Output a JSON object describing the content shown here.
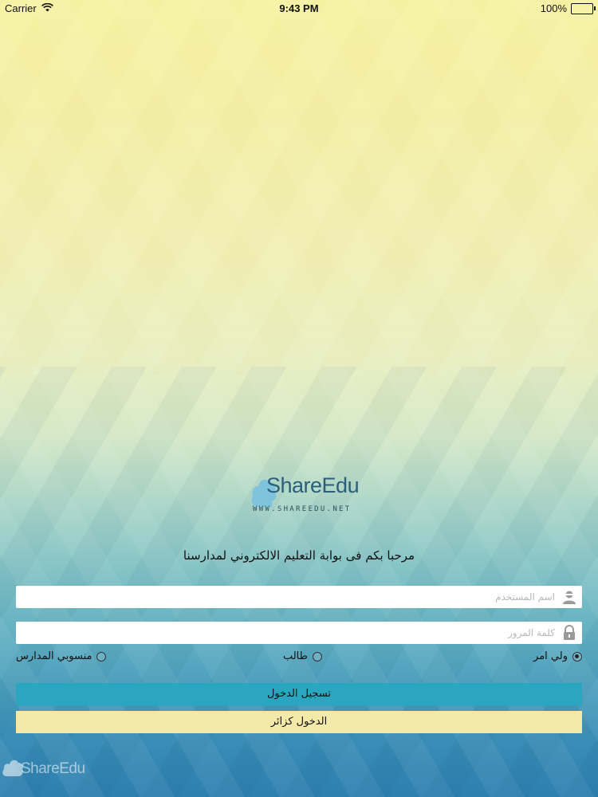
{
  "status_bar": {
    "carrier": "Carrier",
    "time": "9:43 PM",
    "battery": "100%"
  },
  "logo": {
    "name": "ShareEdu",
    "url": "WWW.SHAREEDU.NET"
  },
  "welcome_text": "مرحبا بكم فى بوابة التعليم الالكتروني لمدارسنا",
  "username": {
    "placeholder": "اسم المستخدم",
    "value": ""
  },
  "password": {
    "placeholder": "كلمة المرور",
    "value": ""
  },
  "roles": {
    "options": [
      {
        "label": "ولي امر",
        "selected": true
      },
      {
        "label": "طالب",
        "selected": false
      },
      {
        "label": "منسوبي المدارس",
        "selected": false
      }
    ]
  },
  "buttons": {
    "login": "تسجيل الدخول",
    "guest": "الدخول كزائر"
  },
  "footer": {
    "logo_text": "ShareEdu"
  },
  "colors": {
    "login_button": "#2ba6c0",
    "guest_button": "#f3eaa9"
  }
}
